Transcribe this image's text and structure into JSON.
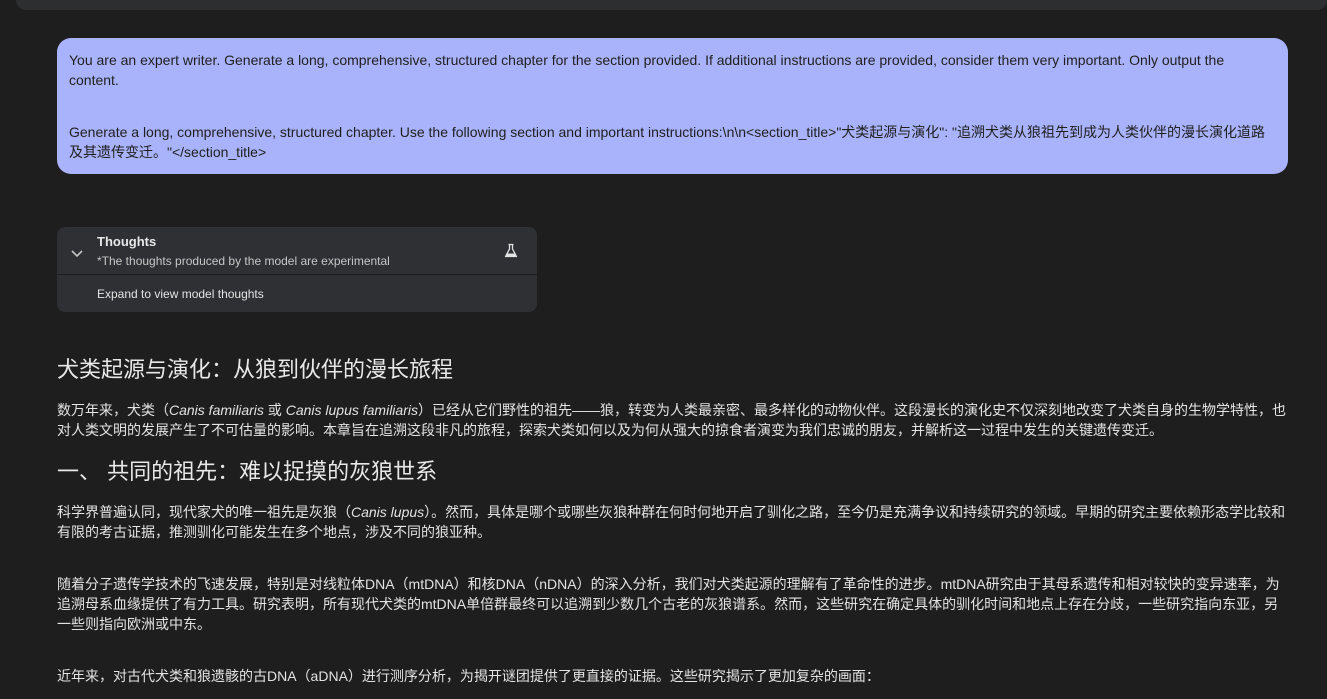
{
  "prompt": {
    "line1": "You are an expert writer. Generate a long, comprehensive, structured chapter for the section provided. If additional instructions are provided, consider them very important. Only output the content.",
    "line2": "Generate a long, comprehensive, structured chapter. Use the following section and important instructions:\\n\\n<section_title>\"犬类起源与演化\": \"追溯犬类从狼祖先到成为人类伙伴的漫长演化道路及其遗传变迁。\"</section_title>"
  },
  "thoughts": {
    "title": "Thoughts",
    "subtitle": "*The thoughts produced by the model are experimental",
    "expand_label": "Expand to view model thoughts"
  },
  "article": {
    "title": "犬类起源与演化：从狼到伙伴的漫长旅程",
    "intro_pre": "数万年来，犬类（",
    "intro_latin1": "Canis familiaris",
    "intro_or": " 或 ",
    "intro_latin2": "Canis lupus familiaris",
    "intro_post": "）已经从它们野性的祖先——狼，转变为人类最亲密、最多样化的动物伙伴。这段漫长的演化史不仅深刻地改变了犬类自身的生物学特性，也对人类文明的发展产生了不可估量的影响。本章旨在追溯这段非凡的旅程，探索犬类如何以及为何从强大的掠食者演变为我们忠诚的朋友，并解析这一过程中发生的关键遗传变迁。",
    "section1_title": "一、 共同的祖先：难以捉摸的灰狼世系",
    "p1_pre": "科学界普遍认同，现代家犬的唯一祖先是灰狼（",
    "p1_latin": "Canis lupus",
    "p1_post": "）。然而，具体是哪个或哪些灰狼种群在何时何地开启了驯化之路，至今仍是充满争议和持续研究的领域。早期的研究主要依赖形态学比较和有限的考古证据，推测驯化可能发生在多个地点，涉及不同的狼亚种。",
    "p2": "随着分子遗传学技术的飞速发展，特别是对线粒体DNA（mtDNA）和核DNA（nDNA）的深入分析，我们对犬类起源的理解有了革命性的进步。mtDNA研究由于其母系遗传和相对较快的变异速率，为追溯母系血缘提供了有力工具。研究表明，所有现代犬类的mtDNA单倍群最终可以追溯到少数几个古老的灰狼谱系。然而，这些研究在确定具体的驯化时间和地点上存在分歧，一些研究指向东亚，另一些则指向欧洲或中东。",
    "p3": "近年来，对古代犬类和狼遗骸的古DNA（aDNA）进行测序分析，为揭开谜团提供了更直接的证据。这些研究揭示了更加复杂的画面："
  }
}
